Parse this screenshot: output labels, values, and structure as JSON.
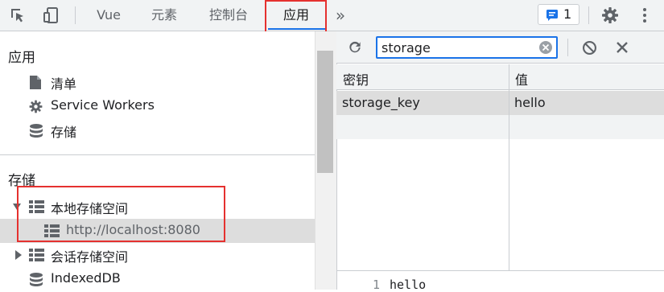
{
  "toolbar": {
    "tabs": [
      {
        "label": "Vue"
      },
      {
        "label": "元素"
      },
      {
        "label": "控制台"
      },
      {
        "label": "应用"
      }
    ],
    "more_label": "»",
    "issues_count": "1"
  },
  "sidebar": {
    "app_section_title": "应用",
    "app_items": [
      {
        "label": "清单",
        "icon": "document-icon"
      },
      {
        "label": "Service Workers",
        "icon": "gear-icon"
      },
      {
        "label": "存储",
        "icon": "database-icon"
      }
    ],
    "storage_section_title": "存储",
    "storage_items": [
      {
        "label": "本地存储空间",
        "icon": "table-icon",
        "expanded": true
      },
      {
        "label": "http://localhost:8080",
        "icon": "table-icon",
        "selected": true
      },
      {
        "label": "会话存储空间",
        "icon": "table-icon",
        "expanded": false
      },
      {
        "label": "IndexedDB",
        "icon": "database-icon"
      }
    ]
  },
  "storage_view": {
    "filter_value": "storage",
    "columns": [
      "密钥",
      "值"
    ],
    "rows": [
      {
        "key": "storage_key",
        "value": "hello"
      }
    ],
    "preview": {
      "line_number": "1",
      "text": "hello"
    }
  },
  "colors": {
    "accent": "#1a73e8",
    "highlight_box": "#e5312f",
    "selected_row": "#dddddd",
    "toolbar_bg": "#f1f3f4"
  }
}
